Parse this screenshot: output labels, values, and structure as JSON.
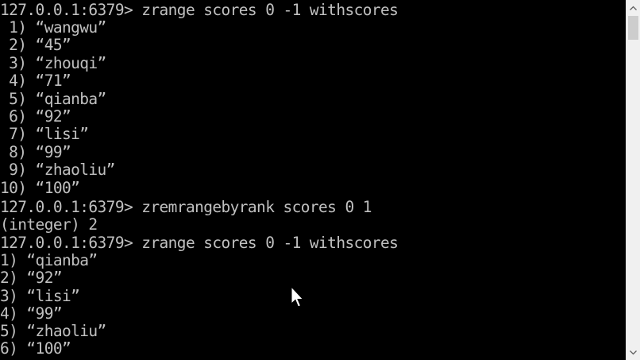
{
  "terminal": {
    "lines": [
      "127.0.0.1:6379> zrange scores 0 -1 withscores",
      " 1) “wangwu”",
      " 2) “45”",
      " 3) “zhouqi”",
      " 4) “71”",
      " 5) “qianba”",
      " 6) “92”",
      " 7) “lisi”",
      " 8) “99”",
      " 9) “zhaoliu”",
      "10) “100”",
      "127.0.0.1:6379> zremrangebyrank scores 0 1",
      "(integer) 2",
      "127.0.0.1:6379> zrange scores 0 -1 withscores",
      "1) “qianba”",
      "2) “92”",
      "3) “lisi”",
      "4) “99”",
      "5) “zhaoliu”",
      "6) “100”"
    ]
  },
  "scrollbar": {
    "up_icon": "chevron-up-icon",
    "down_icon": "chevron-down-icon"
  },
  "colors": {
    "background": "#000000",
    "text": "#c0c0c0",
    "scrollbar_track": "#f0f0f0",
    "scrollbar_thumb": "#cdcdcd"
  }
}
